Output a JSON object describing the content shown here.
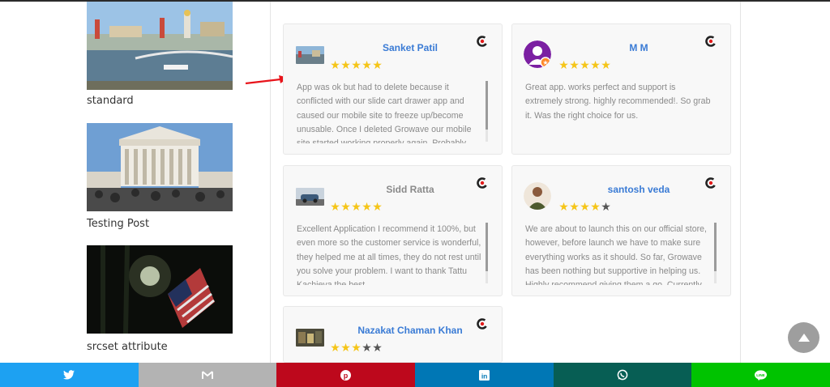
{
  "sidebar": {
    "posts": [
      {
        "title": "standard",
        "image": "moscow-kremlin-river-photo"
      },
      {
        "title": "Testing Post",
        "image": "supreme-court-building-photo"
      },
      {
        "title": "srcset attribute",
        "image": "american-flag-night-photo"
      }
    ]
  },
  "reviews": [
    {
      "name": "Sanket Patil",
      "name_color": "#3a7bd5",
      "rating": 5,
      "avatar": "landscape-thumb",
      "text": "App was ok but had to delete because it conflicted with our slide cart drawer app and caused our mobile site to freeze up/become unusable. Once I deleted Growave our mobile site started working properly again. Probably",
      "scrollable": true
    },
    {
      "name": "M M",
      "name_color": "#3a7bd5",
      "rating": 5,
      "avatar": "purple-user-avatar",
      "text": "Great app. works perfect and support is extremely strong. highly recommended!. So grab it. Was the right choice for us.",
      "scrollable": false
    },
    {
      "name": "Sidd Ratta",
      "name_color": "#8a8a8a",
      "rating": 5,
      "avatar": "car-thumb",
      "text": "Excellent Application I recommend it 100%, but even more so the customer service is wonderful, they helped me at all times, they do not rest until you solve your problem. I want to thank Tattu Kachieva the best",
      "scrollable": true
    },
    {
      "name": "santosh veda",
      "name_color": "#3a7bd5",
      "rating": 4,
      "avatar": "person-photo-avatar",
      "text": "We are about to launch this on our official store, however, before launch we have to make sure everything works as it should. So far, Growave has been nothing but supportive in helping us. Highly recommend giving them a go. Currently",
      "scrollable": true
    },
    {
      "name": "Nazakat Chaman Khan",
      "name_color": "#3a7bd5",
      "rating": 3,
      "avatar": "store-thumb",
      "text": "",
      "scrollable": false
    }
  ],
  "share": [
    {
      "network": "twitter",
      "icon": "twitter-icon",
      "color": "#1da1f2"
    },
    {
      "network": "email",
      "icon": "gmail-icon",
      "color": "#b3b3b3"
    },
    {
      "network": "pinterest",
      "icon": "pinterest-icon",
      "color": "#bd081c"
    },
    {
      "network": "linkedin",
      "icon": "linkedin-icon",
      "color": "#0077b5"
    },
    {
      "network": "whatsapp",
      "icon": "whatsapp-icon",
      "color": "#075e54"
    },
    {
      "network": "line",
      "icon": "line-icon",
      "color": "#00c300"
    }
  ],
  "colors": {
    "star_on": "#f5c518",
    "star_off": "#555555",
    "annotation_arrow": "#e8141b",
    "back_to_top": "#9e9e9e"
  }
}
